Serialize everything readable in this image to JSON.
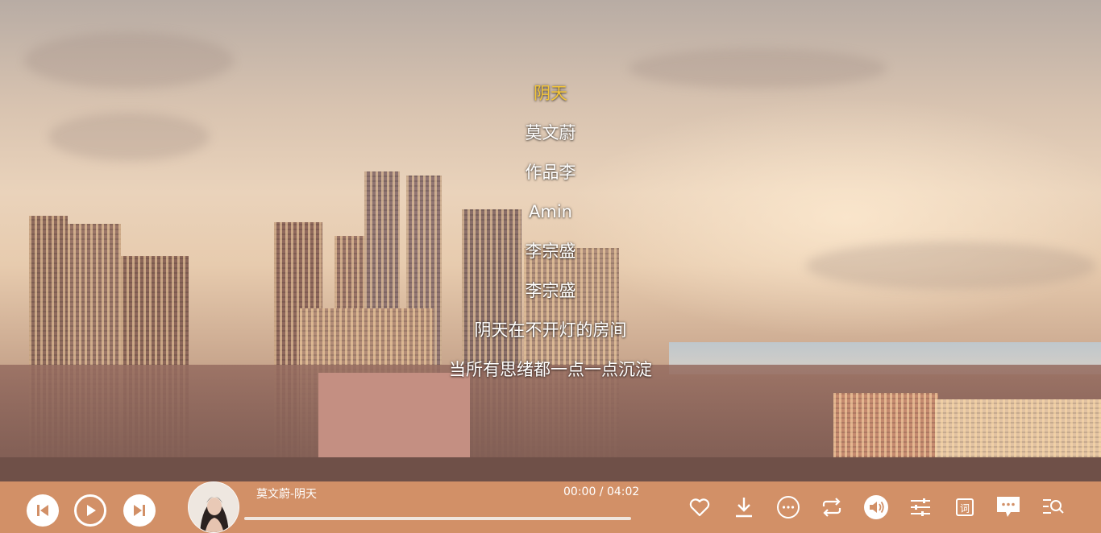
{
  "lyrics": [
    {
      "text": "阴天",
      "active": true
    },
    {
      "text": "莫文蔚",
      "active": false
    },
    {
      "text": "作品李",
      "active": false
    },
    {
      "text": "Amin",
      "active": false
    },
    {
      "text": "李宗盛",
      "active": false
    },
    {
      "text": "李宗盛",
      "active": false
    },
    {
      "text": "阴天在不开灯的房间",
      "active": false
    },
    {
      "text": "当所有思绪都一点一点沉淀",
      "active": false
    }
  ],
  "player": {
    "song_title": "莫文蔚-阴天",
    "time": "00:00 / 04:02",
    "progress": 0,
    "bar_color": "#d29067",
    "active_lyric_color": "#f3c53b"
  },
  "icons": {
    "prev": "skip-previous-icon",
    "play": "play-icon",
    "next": "skip-next-icon",
    "like": "heart-icon",
    "download": "download-icon",
    "more": "more-icon",
    "loop": "loop-icon",
    "volume": "volume-icon",
    "equalizer": "settings-sliders-icon",
    "lyric": "lyric-icon",
    "comment": "comment-icon",
    "search_lyric": "search-list-icon"
  }
}
